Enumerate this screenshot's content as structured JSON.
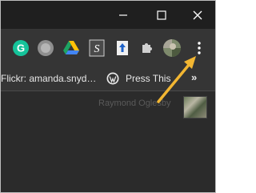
{
  "window": {
    "minimize_icon": "minimize-icon",
    "maximize_icon": "maximize-icon",
    "close_icon": "close-icon"
  },
  "toolbar": {
    "extensions": [
      {
        "name": "grammarly",
        "letter": "G",
        "color": "#15c39a"
      },
      {
        "name": "gray-circle-extension",
        "color": "#9e9e9e"
      },
      {
        "name": "google-drive",
        "color": "#1da462"
      },
      {
        "name": "script-s",
        "letter": "S",
        "color": "#ffffff"
      },
      {
        "name": "upload-extension",
        "color": "#1e62c8"
      },
      {
        "name": "extensions-puzzle",
        "color": "#d0d0d0"
      },
      {
        "name": "profile-avatar"
      }
    ],
    "menu_icon": "three-dot-menu-icon"
  },
  "bookmarks": {
    "items": [
      {
        "label": "Flickr: amanda.snyd…"
      },
      {
        "label": "Press This",
        "icon": "wordpress-icon"
      }
    ],
    "more": "»"
  },
  "content": {
    "photo_credit": "Raymond Oglesby"
  },
  "annotation": {
    "arrow_color": "#f2b632"
  }
}
